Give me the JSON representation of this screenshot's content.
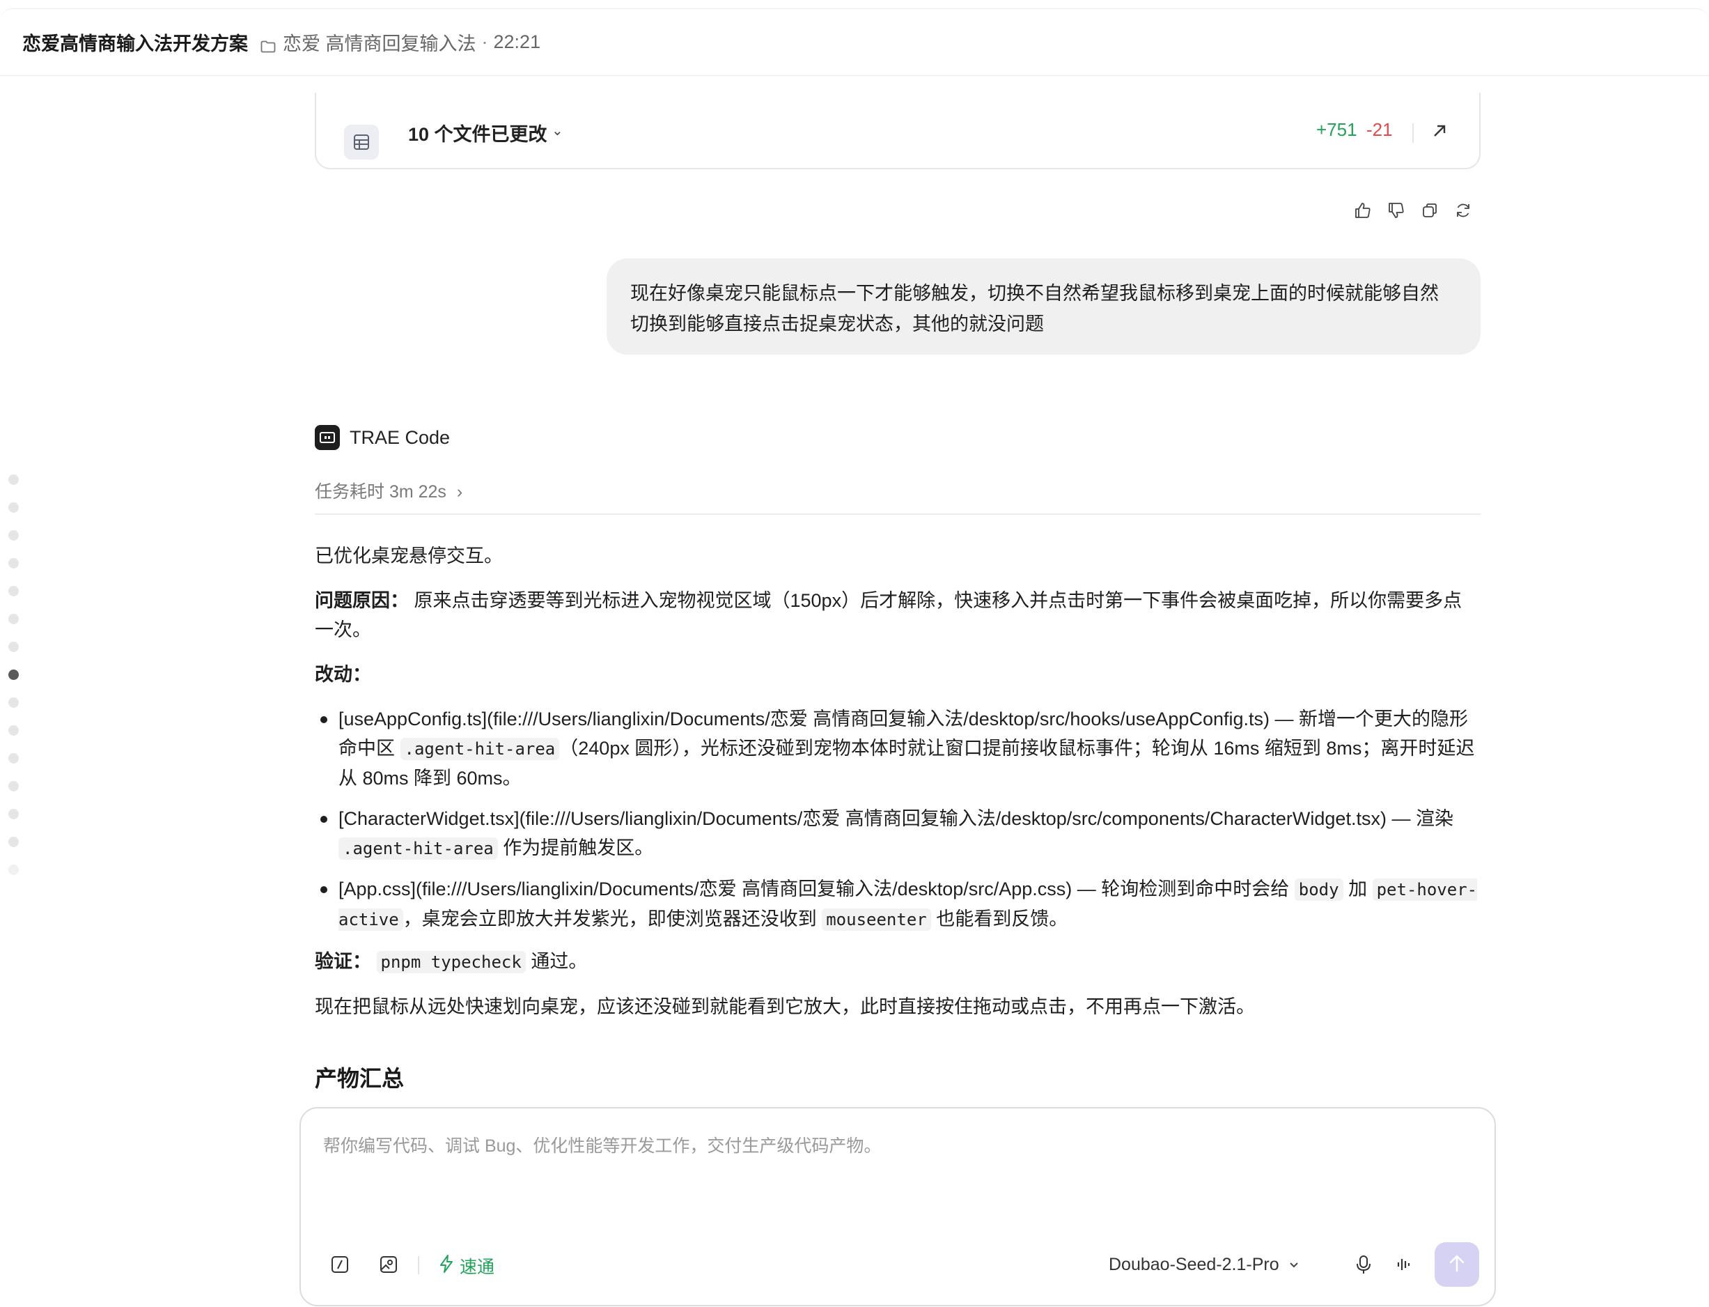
{
  "header": {
    "title": "恋爱高情商输入法开发方案",
    "path": "恋爱 高情商回复输入法",
    "separator": "·",
    "time": "22:21"
  },
  "files_card": {
    "label": "10 个文件已更改",
    "additions": "+751",
    "deletions": "-21"
  },
  "user_message": "现在好像桌宠只能鼠标点一下才能够触发，切换不自然希望我鼠标移到桌宠上面的时候就能够自然切换到能够直接点击捉桌宠状态，其他的就没问题",
  "assistant": {
    "name": "TRAE Code",
    "task_time": "任务耗时 3m 22s",
    "task_time_chevron": "›",
    "intro": "已优化桌宠悬停交互。",
    "cause_label": "问题原因：",
    "cause_text": " 原来点击穿透要等到光标进入宠物视觉区域（150px）后才解除，快速移入并点击时第一下事件会被桌面吃掉，所以你需要多点一次。",
    "changes_label": "改动：",
    "changes": [
      {
        "p1": "[useAppConfig.ts](file:///Users/lianglixin/Documents/恋爱 高情商回复输入法/desktop/src/hooks/useAppConfig.ts) — 新增一个更大的隐形命中区 ",
        "code1": ".agent-hit-area",
        "p2": "（240px 圆形），光标还没碰到宠物本体时就让窗口提前接收鼠标事件；轮询从 16ms 缩短到 8ms；离开时延迟从 80ms 降到 60ms。"
      },
      {
        "p1": "[CharacterWidget.tsx](file:///Users/lianglixin/Documents/恋爱 高情商回复输入法/desktop/src/components/CharacterWidget.tsx) — 渲染 ",
        "code1": ".agent-hit-area",
        "p2": " 作为提前触发区。"
      },
      {
        "p1": "[App.css](file:///Users/lianglixin/Documents/恋爱 高情商回复输入法/desktop/src/App.css) — 轮询检测到命中时会给 ",
        "code1": "body",
        "p2": " 加 ",
        "code2": "pet-hover-active",
        "p3": "，桌宠会立即放大并发紫光，即使浏览器还没收到 ",
        "code3": "mouseenter",
        "p4": " 也能看到反馈。"
      }
    ],
    "verify_label": "验证：",
    "verify_code": "pnpm typecheck",
    "verify_text": " 通过。",
    "closing": "现在把鼠标从远处快速划向桌宠，应该还没碰到就能看到它放大，此时直接按住拖动或点击，不用再点一下激活。",
    "artifacts_title": "产物汇总"
  },
  "composer": {
    "placeholder": "帮你编写代码、调试 Bug、优化性能等开发工作，交付生产级代码产物。",
    "mode_label": "速通",
    "model": "Doubao-Seed-2.1-Pro"
  },
  "icons": {
    "folder": "folder-icon",
    "files": "file-list-icon",
    "expand": "expand-arrow-icon",
    "thumbs_up": "thumbs-up-icon",
    "thumbs_down": "thumbs-down-icon",
    "copy": "copy-icon",
    "regenerate": "refresh-icon",
    "slash_command": "slash-command-icon",
    "image_upload": "image-upload-icon",
    "lightning": "lightning-icon",
    "chevron_down": "chevron-down-icon",
    "microphone": "microphone-icon",
    "voice_wave": "voice-wave-icon",
    "send": "send-arrow-icon"
  },
  "colors": {
    "accent_green": "#22a45a",
    "deletion_red": "#e5484d",
    "send_button": "#d6d2f4",
    "user_bubble": "#f0f0f0"
  }
}
